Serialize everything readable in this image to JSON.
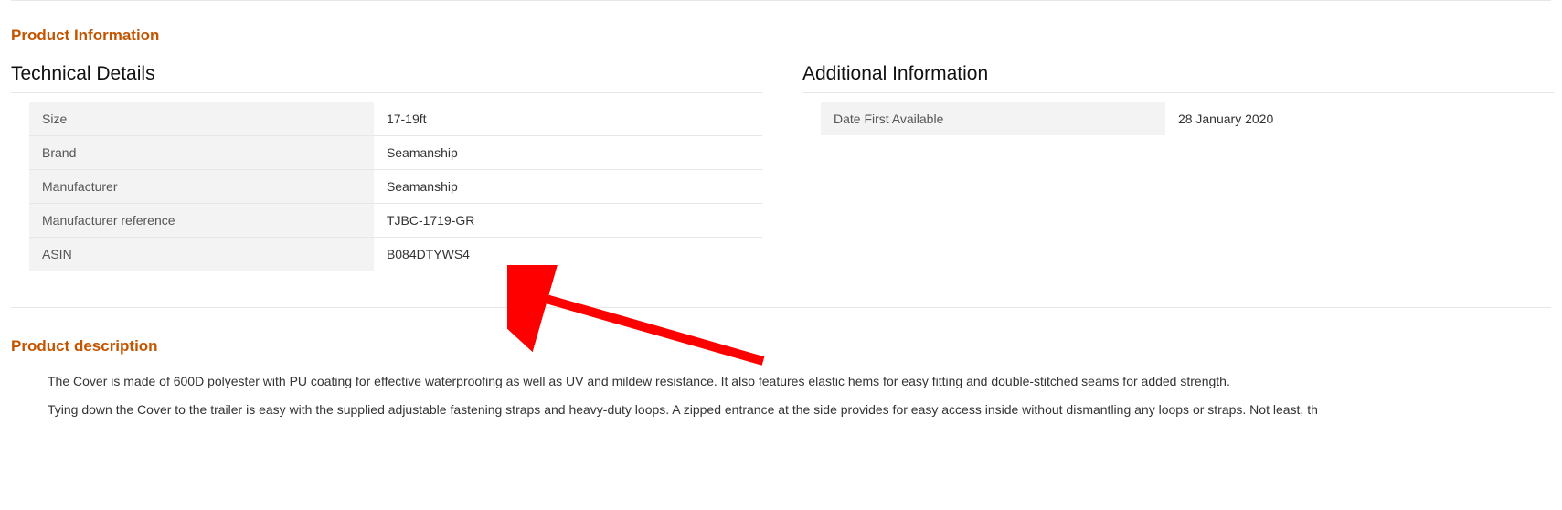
{
  "headings": {
    "product_information": "Product Information",
    "technical_details": "Technical Details",
    "additional_information": "Additional Information",
    "product_description": "Product description"
  },
  "technical_details": {
    "rows": [
      {
        "label": "Size",
        "value": "17-19ft"
      },
      {
        "label": "Brand",
        "value": "Seamanship"
      },
      {
        "label": "Manufacturer",
        "value": "Seamanship"
      },
      {
        "label": "Manufacturer reference",
        "value": "TJBC-1719-GR"
      },
      {
        "label": "ASIN",
        "value": "B084DTYWS4"
      }
    ]
  },
  "additional_information": {
    "rows": [
      {
        "label": "Date First Available",
        "value": "28 January 2020"
      }
    ]
  },
  "description": {
    "p1": "The Cover is made of 600D polyester with PU coating for effective waterproofing as well as UV and mildew resistance. It also features elastic hems for easy fitting and double-stitched seams for added strength.",
    "p2": "Tying down the Cover to the trailer is easy with the supplied adjustable fastening straps and heavy-duty loops. A zipped entrance at the side provides for easy access inside without dismantling any loops or straps. Not least, th"
  },
  "annotation": {
    "arrow_color": "#ff0000"
  }
}
